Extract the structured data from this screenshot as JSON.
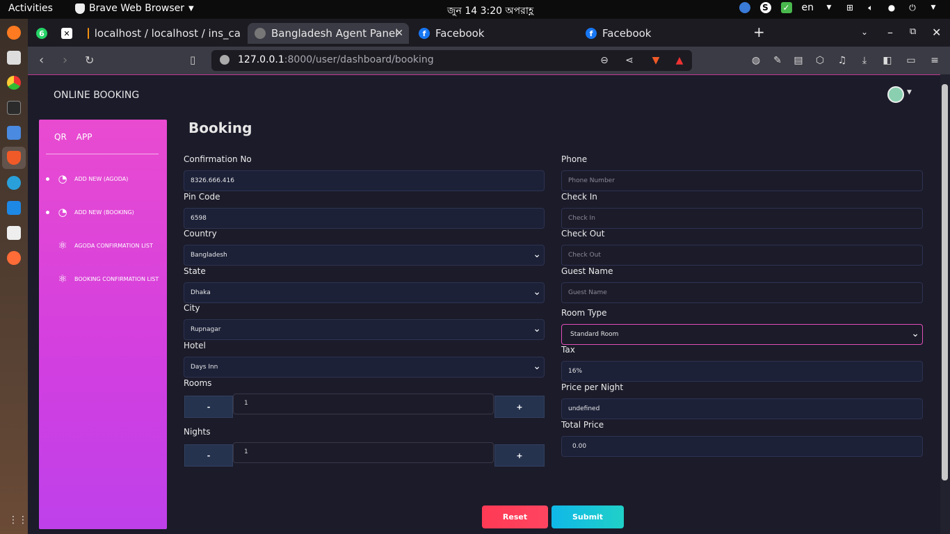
{
  "system": {
    "activities": "Activities",
    "app_name": "Brave Web Browser",
    "clock": "জুন 14   3:20 অপরাহ্ণ",
    "lang": "en"
  },
  "browser": {
    "tabs": [
      {
        "label": "localhost / localhost / ins_ca",
        "active": false
      },
      {
        "label": "Bangladesh Agent Panel",
        "active": true
      },
      {
        "label": "Facebook",
        "active": false
      },
      {
        "label": "Facebook",
        "active": false
      }
    ],
    "whatsapp_badge": "6",
    "url_host": "127.0.0.1",
    "url_rest": ":8000/user/dashboard/booking"
  },
  "page": {
    "brand": "ONLINE BOOKING",
    "title": "Booking"
  },
  "sidebar": {
    "logo_left": "QR",
    "logo_right": "APP",
    "items": [
      {
        "label": "ADD NEW (AGODA)"
      },
      {
        "label": "ADD NEW (BOOKING)"
      },
      {
        "label": "AGODA CONFIRMATION LIST"
      },
      {
        "label": "BOOKING CONFIRMATION LIST"
      }
    ]
  },
  "form": {
    "confirmation_no": {
      "label": "Confirmation No",
      "value": "8326.666.416"
    },
    "pin_code": {
      "label": "Pin Code",
      "value": "6598"
    },
    "country": {
      "label": "Country",
      "value": "Bangladesh"
    },
    "state": {
      "label": "State",
      "value": "Dhaka"
    },
    "city": {
      "label": "City",
      "value": "Rupnagar"
    },
    "hotel": {
      "label": "Hotel",
      "value": "Days Inn"
    },
    "rooms": {
      "label": "Rooms",
      "value": "1",
      "minus": "-",
      "plus": "+"
    },
    "nights": {
      "label": "Nights",
      "value": "1",
      "minus": "-",
      "plus": "+"
    },
    "phone": {
      "label": "Phone",
      "placeholder": "Phone Number"
    },
    "check_in": {
      "label": "Check In",
      "placeholder": "Check In"
    },
    "check_out": {
      "label": "Check Out",
      "placeholder": "Check Out"
    },
    "guest_name": {
      "label": "Guest Name",
      "placeholder": "Guest Name"
    },
    "room_type": {
      "label": "Room Type",
      "value": "Standard Room"
    },
    "tax": {
      "label": "Tax",
      "value": "16%"
    },
    "price_per_night": {
      "label": "Price per Night",
      "value": "undefined"
    },
    "total_price": {
      "label": "Total Price",
      "value": "0.00"
    },
    "reset": "Reset",
    "submit": "Submit"
  },
  "colors": {
    "sidebar_gradient_top": "#e94bd0",
    "sidebar_gradient_bottom": "#be40ea",
    "reset": "#ff3a55",
    "submit": "#10b8e8"
  }
}
